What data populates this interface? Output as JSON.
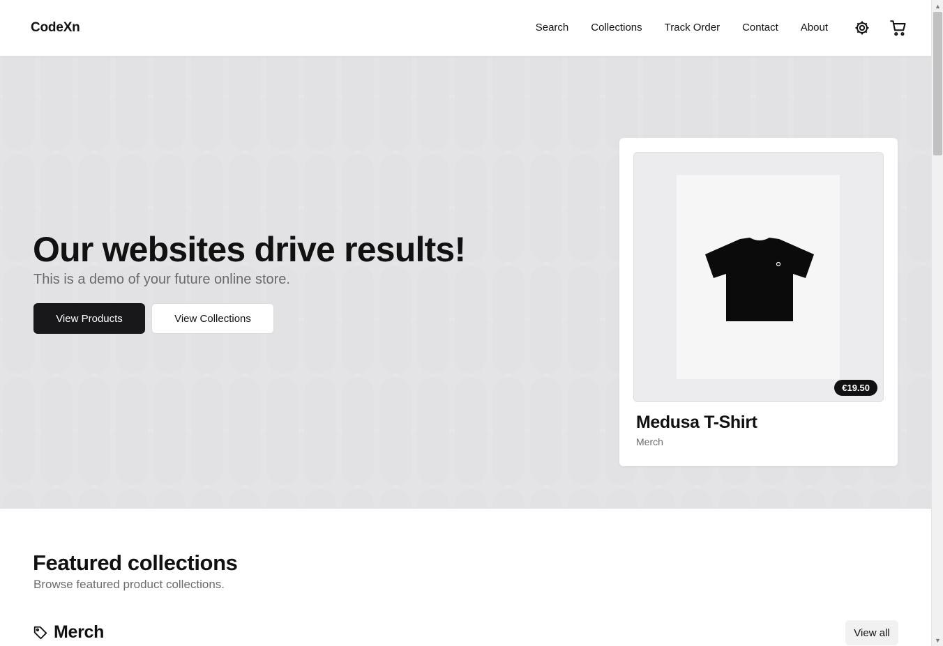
{
  "header": {
    "brand": "CodeXn",
    "nav": [
      "Search",
      "Collections",
      "Track Order",
      "Contact",
      "About"
    ],
    "icons": {
      "settings": "gear-icon",
      "cart": "cart-icon"
    }
  },
  "hero": {
    "title": "Our websites drive results!",
    "subtitle": "This is a demo of your future online store.",
    "primary_button": "View Products",
    "secondary_button": "View Collections",
    "product": {
      "price": "€19.50",
      "name": "Medusa T-Shirt",
      "category": "Merch",
      "image_icon": "tshirt-icon"
    }
  },
  "featured": {
    "title": "Featured collections",
    "subtitle": "Browse featured product collections.",
    "collection": {
      "name": "Merch",
      "icon": "tag-icon",
      "view_all": "View all"
    }
  },
  "colors": {
    "hero_bg": "#e6e6e8",
    "primary_button_bg": "#18181b",
    "text": "#111111",
    "muted": "#6b6b6b"
  }
}
